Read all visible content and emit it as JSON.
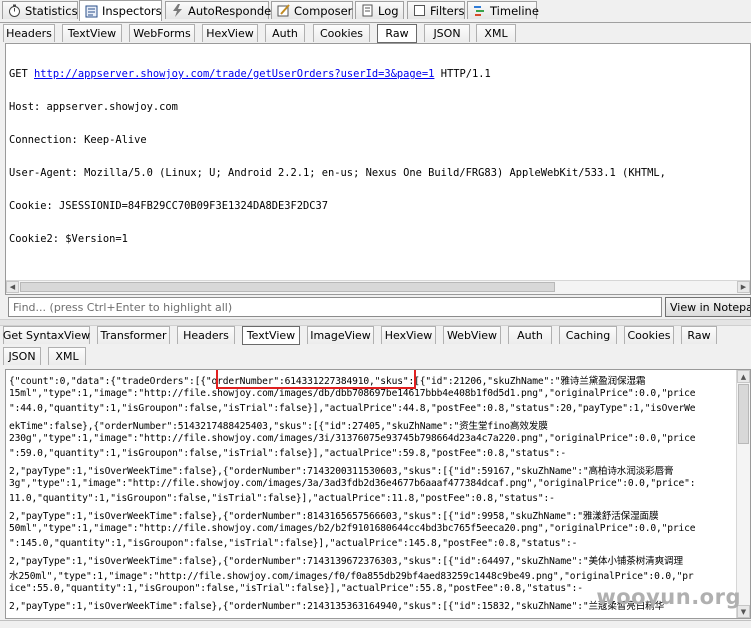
{
  "main_tabs": [
    {
      "label": "Statistics",
      "icon": "stopwatch-icon",
      "active": false
    },
    {
      "label": "Inspectors",
      "icon": "inspector-icon",
      "active": true
    },
    {
      "label": "AutoResponder",
      "icon": "lightning-icon",
      "active": false
    },
    {
      "label": "Composer",
      "icon": "compose-icon",
      "active": false
    },
    {
      "label": "Log",
      "icon": "log-icon",
      "active": false
    },
    {
      "label": "Filters",
      "icon": "filter-checkbox-icon",
      "active": false
    },
    {
      "label": "Timeline",
      "icon": "timeline-icon",
      "active": false
    }
  ],
  "request_tabs": [
    "Headers",
    "TextView",
    "WebForms",
    "HexView",
    "Auth",
    "Cookies",
    "Raw",
    "JSON",
    "XML"
  ],
  "request_active": "Raw",
  "request": {
    "method": "GET",
    "url": "http://appserver.showjoy.com/trade/getUserOrders?userId=3&page=1",
    "protocol": "HTTP/1.1",
    "lines": [
      "Host: appserver.showjoy.com",
      "Connection: Keep-Alive",
      "User-Agent: Mozilla/5.0 (Linux; U; Android 2.2.1; en-us; Nexus One Build/FRG83) AppleWebKit/533.1 (KHTML,",
      "Cookie: JSESSIONID=84FB29CC70B09F3E1324DA8DE3F2DC37",
      "Cookie2: $Version=1"
    ]
  },
  "find_placeholder": "Find... (press Ctrl+Enter to highlight all)",
  "view_notepad": "View in Notepad",
  "response_tabs_row1": [
    "Get SyntaxView",
    "Transformer",
    "Headers",
    "TextView",
    "ImageView",
    "HexView",
    "WebView",
    "Auth",
    "Caching",
    "Cookies",
    "Raw"
  ],
  "response_tabs_row2": [
    "JSON",
    "XML"
  ],
  "response_active": "TextView",
  "response_lines": [
    "{\"count\":0,\"data\":{\"tradeOrders\":[{\"orderNumber\":614331227384910,\"skus\":[{\"id\":21206,\"skuZhName\":\"雅诗兰黛盈润保湿霜",
    "15ml\",\"type\":1,\"image\":\"http://file.showjoy.com/images/db/dbb708697be14617bbb4e408b1f0d5d1.png\",\"originalPrice\":0.0,\"price",
    "\":44.0,\"quantity\":1,\"isGroupon\":false,\"isTrial\":false}],\"actualPrice\":44.8,\"postFee\":0.8,\"status\":20,\"payType\":1,\"isOverWe",
    "ekTime\":false},{\"orderNumber\":5143217488425403,\"skus\":[{\"id\":27405,\"skuZhName\":\"资生堂fino高效发膜",
    "230g\",\"type\":1,\"image\":\"http://file.showjoy.com/images/3i/31376075e93745b798664d23a4c7a220.png\",\"originalPrice\":0.0,\"price",
    "\":59.0,\"quantity\":1,\"isGroupon\":false,\"isTrial\":false}],\"actualPrice\":59.8,\"postFee\":0.8,\"status\":-",
    "2,\"payType\":1,\"isOverWeekTime\":false},{\"orderNumber\":7143200311530603,\"skus\":[{\"id\":59167,\"skuZhName\":\"高柏诗水润淡彩唇膏",
    "3g\",\"type\":1,\"image\":\"http://file.showjoy.com/images/3a/3ad3fdb2d36e4677b6aaaf477384dcaf.png\",\"originalPrice\":0.0,\"price\":",
    "11.0,\"quantity\":1,\"isGroupon\":false,\"isTrial\":false}],\"actualPrice\":11.8,\"postFee\":0.8,\"status\":-",
    "2,\"payType\":1,\"isOverWeekTime\":false},{\"orderNumber\":8143165657566603,\"skus\":[{\"id\":9958,\"skuZhName\":\"雅漾舒活保湿面膜",
    "50ml\",\"type\":1,\"image\":\"http://file.showjoy.com/images/b2/b2f9101680644cc4bd3bc765f5eeca20.png\",\"originalPrice\":0.0,\"price",
    "\":145.0,\"quantity\":1,\"isGroupon\":false,\"isTrial\":false}],\"actualPrice\":145.8,\"postFee\":0.8,\"status\":-",
    "2,\"payType\":1,\"isOverWeekTime\":false},{\"orderNumber\":7143139672376303,\"skus\":[{\"id\":64497,\"skuZhName\":\"美体小铺茶树清爽调理",
    "水250ml\",\"type\":1,\"image\":\"http://file.showjoy.com/images/f0/f0a855db29bf4aed83259c1448c9be49.png\",\"originalPrice\":0.0,\"pr",
    "ice\":55.0,\"quantity\":1,\"isGroupon\":false,\"isTrial\":false}],\"actualPrice\":55.8,\"postFee\":0.8,\"status\":-",
    "2,\"payType\":1,\"isOverWeekTime\":false},{\"orderNumber\":2143135363164940,\"skus\":[{\"id\":15832,\"skuZhName\":\"兰蔻柔皙亮白精华"
  ],
  "watermark": "wooyun.org",
  "colors": {
    "highlight_border": "#e02020",
    "link": "#0000ee",
    "pane_border": "#9a9a9a"
  }
}
